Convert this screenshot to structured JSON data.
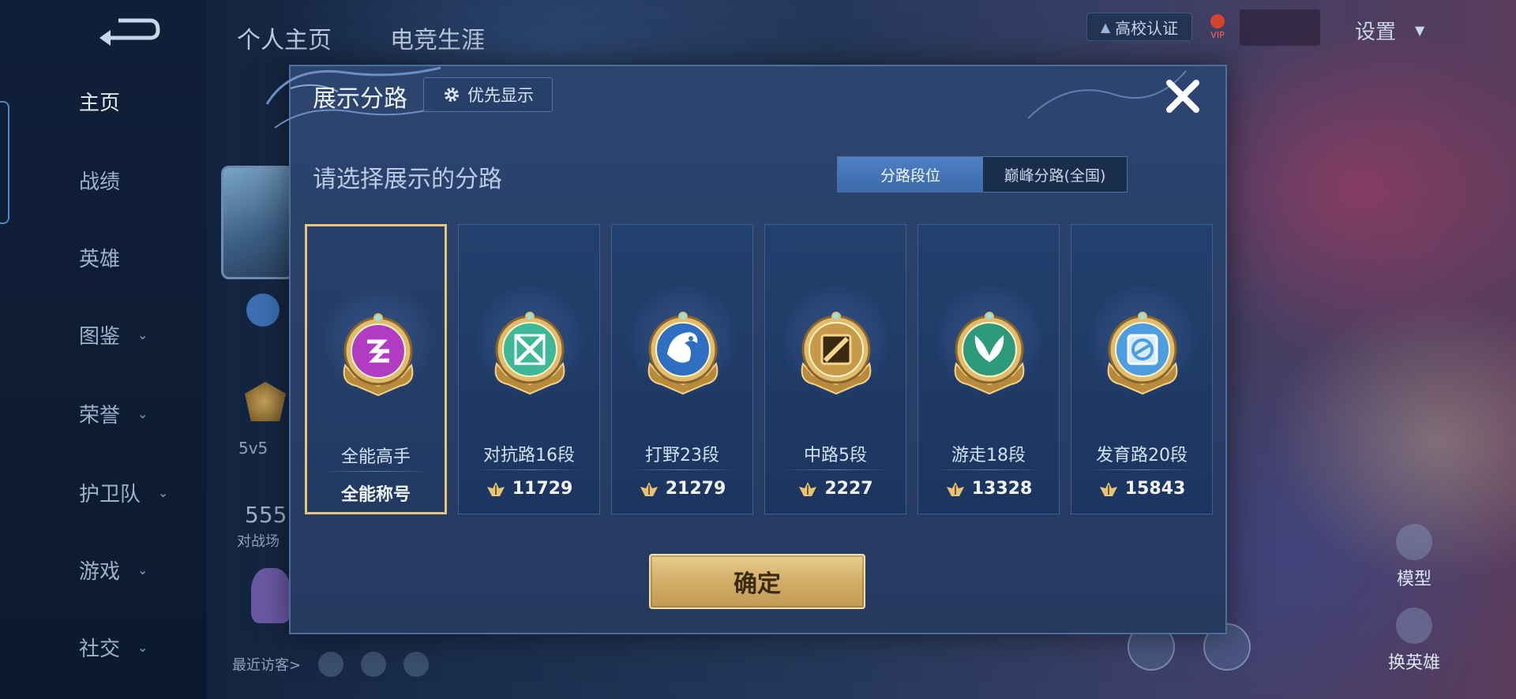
{
  "sidebar": {
    "items": [
      {
        "label": "主页",
        "active": true,
        "expandable": false
      },
      {
        "label": "战绩",
        "active": false,
        "expandable": false
      },
      {
        "label": "英雄",
        "active": false,
        "expandable": false
      },
      {
        "label": "图鉴",
        "active": false,
        "expandable": true
      },
      {
        "label": "荣誉",
        "active": false,
        "expandable": true
      },
      {
        "label": "护卫队",
        "active": false,
        "expandable": true
      },
      {
        "label": "游戏",
        "active": false,
        "expandable": true
      },
      {
        "label": "社交",
        "active": false,
        "expandable": true
      }
    ]
  },
  "top": {
    "tabs": [
      "个人主页",
      "电竞生涯"
    ],
    "campus_badge": "高校认证",
    "vip_label": "VIP",
    "settings_label": "设置"
  },
  "background": {
    "peek_mode_label": "5v5",
    "peek_count": "555",
    "peek_count_label": "对战场",
    "recent_visitors_label": "最近访客>",
    "skin_label": "模型",
    "change_hero_label": "换英雄"
  },
  "modal": {
    "title": "展示分路",
    "pref_button": "优先显示",
    "subtitle": "请选择展示的分路",
    "segments": [
      "分路段位",
      "巅峰分路(全国)"
    ],
    "active_segment": 0,
    "cards": [
      {
        "name": "全能高手",
        "value": "全能称号",
        "has_icon": false,
        "selected": true,
        "emblem": "all-round",
        "color": "#b23bc4"
      },
      {
        "name": "对抗路16段",
        "value": "11729",
        "has_icon": true,
        "selected": false,
        "emblem": "clash-lane",
        "color": "#3fb89a"
      },
      {
        "name": "打野23段",
        "value": "21279",
        "has_icon": true,
        "selected": false,
        "emblem": "jungle",
        "color": "#2f6fc2"
      },
      {
        "name": "中路5段",
        "value": "2227",
        "has_icon": true,
        "selected": false,
        "emblem": "mid-lane",
        "color": "#c79a4a"
      },
      {
        "name": "游走18段",
        "value": "13328",
        "has_icon": true,
        "selected": false,
        "emblem": "roam",
        "color": "#2e9a7c"
      },
      {
        "name": "发育路20段",
        "value": "15843",
        "has_icon": true,
        "selected": false,
        "emblem": "farm-lane",
        "color": "#4c9ee0"
      }
    ],
    "confirm_button": "确定"
  },
  "colors": {
    "accent_gold": "#e7c47a",
    "segment_active": "#4f80c4",
    "modal_bg": "#2a4068"
  }
}
